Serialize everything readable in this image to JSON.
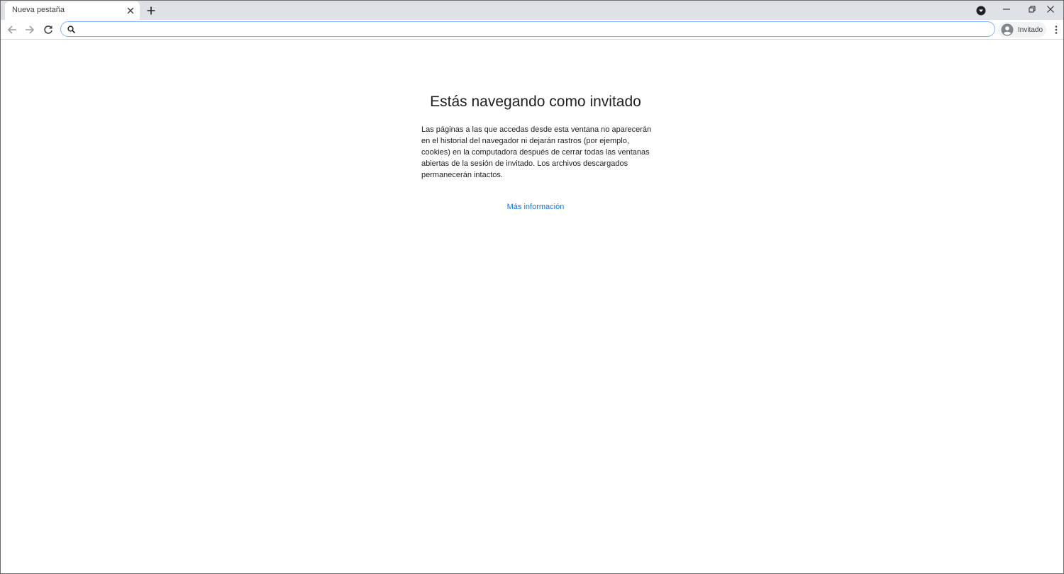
{
  "tab": {
    "title": "Nueva pestaña"
  },
  "omnibox": {
    "value": "",
    "placeholder": ""
  },
  "profile": {
    "label": "Invitado"
  },
  "page": {
    "title": "Estás navegando como invitado",
    "description": "Las páginas a las que accedas desde esta ventana no aparecerán en el historial del navegador ni dejarán rastros (por ejemplo, cookies) en la computadora después de cerrar todas las ventanas abiertas de la sesión de invitado. Los archivos descargados permanecerán intactos.",
    "learn_more": "Más información"
  },
  "icons": {
    "tab_close": "close-icon",
    "new_tab": "plus-icon",
    "tab_search": "chevron-down-circle-icon",
    "minimize": "minimize-icon",
    "restore": "restore-icon",
    "close": "close-icon",
    "back": "arrow-back-icon",
    "forward": "arrow-forward-icon",
    "reload": "reload-icon",
    "search": "search-icon",
    "avatar": "account-circle-icon",
    "menu": "more-vert-icon"
  },
  "colors": {
    "tabstrip": "#dee1e6",
    "link": "#1a73e8",
    "omnibox_border": "#8ab4f8"
  }
}
